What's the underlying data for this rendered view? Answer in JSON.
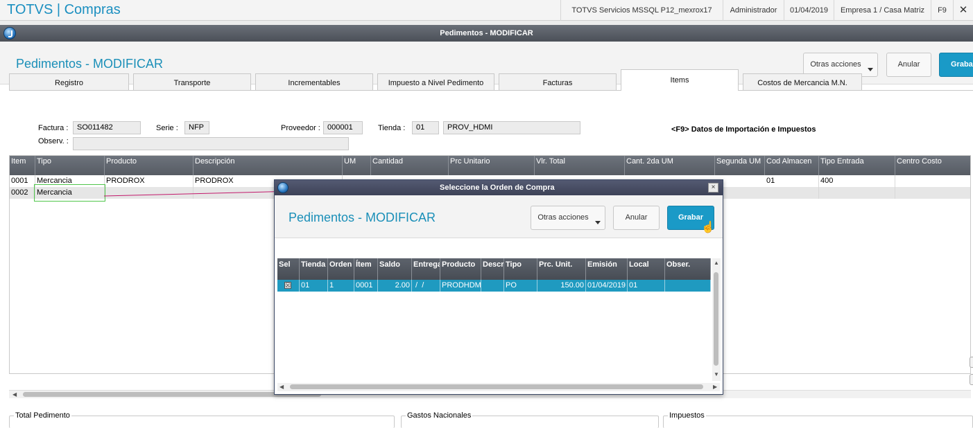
{
  "topbar": {
    "app_title": "TOTVS | Compras",
    "server": "TOTVS Servicios MSSQL P12_mexrox17",
    "user": "Administrador",
    "date": "01/04/2019",
    "company": "Empresa 1 / Casa Matriz",
    "shortcut": "F9",
    "close": "✕"
  },
  "window": {
    "title": "Pedimentos - MODIFICAR",
    "page_title": "Pedimentos - MODIFICAR",
    "buttons": {
      "more": "Otras acciones",
      "cancel": "Anular",
      "save": "Grabar"
    }
  },
  "tabs": [
    "Registro",
    "Transporte",
    "Incrementables",
    "Impuesto a Nivel Pedimento",
    "Facturas",
    "Items",
    "Costos de Mercancia M.N."
  ],
  "form": {
    "factura_label": "Factura :",
    "factura_value": "SO011482",
    "serie_label": "Serie :",
    "serie_value": "NFP",
    "proveedor_label": "Proveedor :",
    "proveedor_value": "000001",
    "tienda_label": "Tienda :",
    "tienda_value": "01",
    "tienda_name": "PROV_HDMI",
    "observ_label": "Observ. :",
    "hint": "<F9> Datos de Importación e Impuestos"
  },
  "grid": {
    "headers": [
      "Item",
      "Tipo",
      "Producto",
      "Descripción",
      "UM",
      "Cantidad",
      "Prc Unitario",
      "Vlr. Total",
      "Cant. 2da UM",
      "Segunda UM",
      "Cod Almacen",
      "Tipo Entrada",
      "Centro Costo"
    ],
    "rows": [
      [
        "0001",
        "Mercancia",
        "PRODROX",
        "PRODROX",
        "",
        "",
        "",
        "",
        "",
        "",
        "01",
        "400",
        ""
      ],
      [
        "0002",
        "Mercancia",
        "",
        "",
        "",
        "",
        "",
        "",
        "",
        "",
        "",
        "",
        ""
      ]
    ]
  },
  "bottom_panels": [
    "Total Pedimento",
    "Gastos Nacionales",
    "Impuestos"
  ],
  "modal": {
    "title": "Seleccione la Orden de Compra",
    "close": "×",
    "page_title": "Pedimentos - MODIFICAR",
    "buttons": {
      "more": "Otras acciones",
      "cancel": "Anular",
      "save": "Grabar"
    },
    "headers": [
      "Sel",
      "Tienda",
      "Orden",
      "Ítem",
      "Saldo",
      "Entrega",
      "Producto",
      "Descr",
      "Tipo",
      "Prc. Unit.",
      "Emisión",
      "Local",
      "Obser."
    ],
    "rows": [
      {
        "sel": "☒",
        "tienda": "01",
        "orden": "1",
        "item": "0001",
        "saldo": "2.00",
        "entrega": " /  /",
        "producto": "PRODHDMI",
        "descr": "",
        "tipo": "PO",
        "prc_unit": "150.00",
        "emision": "01/04/2019",
        "local": "01",
        "obser": ""
      }
    ]
  }
}
